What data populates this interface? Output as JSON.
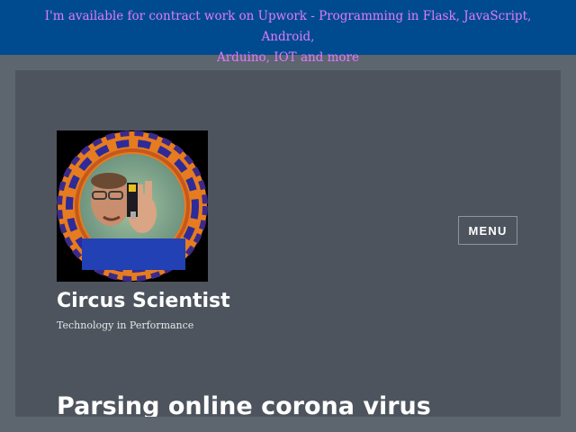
{
  "banner": {
    "line1": "I'm available for contract work on Upwork - Programming in Flask, JavaScript, Android,",
    "line2": "Arduino, IOT and more"
  },
  "header": {
    "logo_icon": "portrait-logo-icon",
    "menu_label": "MENU",
    "site_title": "Circus Scientist",
    "tagline": "Technology in Performance"
  },
  "post": {
    "title": "Parsing online corona virus"
  },
  "colors": {
    "banner_bg": "#004b8f",
    "banner_text": "#d36cf5",
    "page_bg": "#5d656f",
    "panel_bg": "#4d545d"
  }
}
